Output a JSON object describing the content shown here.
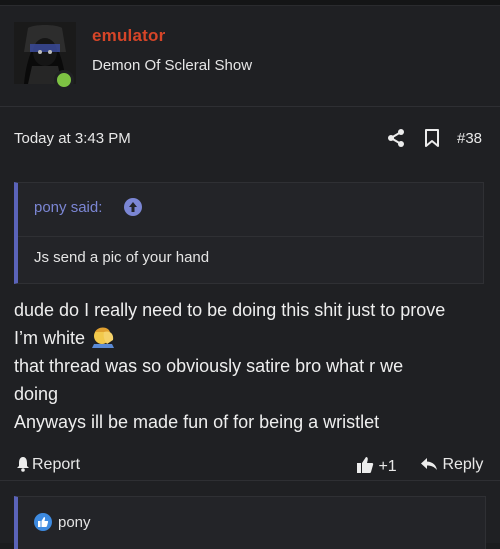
{
  "user": {
    "username": "emulator",
    "title": "Demon Of Scleral Show",
    "online": true,
    "username_color": "#d64528"
  },
  "post": {
    "date": "Today at 3:43 PM",
    "number": "#38",
    "icons": {
      "share": "share-icon",
      "bookmark": "bookmark-icon"
    }
  },
  "quote": {
    "author": "pony said:",
    "body": "Js send a pic of your hand",
    "jump_icon": "arrow-up-circle-icon",
    "accent": "#5a63b9"
  },
  "message": {
    "lines": [
      "dude do I really need to be doing this shit just to prove",
      "I’m white",
      "that thread was so obviously satire bro what r we",
      "doing",
      "Anyways ill be made fun of for being a wristlet"
    ],
    "emoji": "facepalm-emoji"
  },
  "actions": {
    "report": "Report",
    "like_count": "+1",
    "reply": "Reply"
  },
  "reactions": {
    "user": "pony",
    "icon": "thumbs-up-icon"
  }
}
